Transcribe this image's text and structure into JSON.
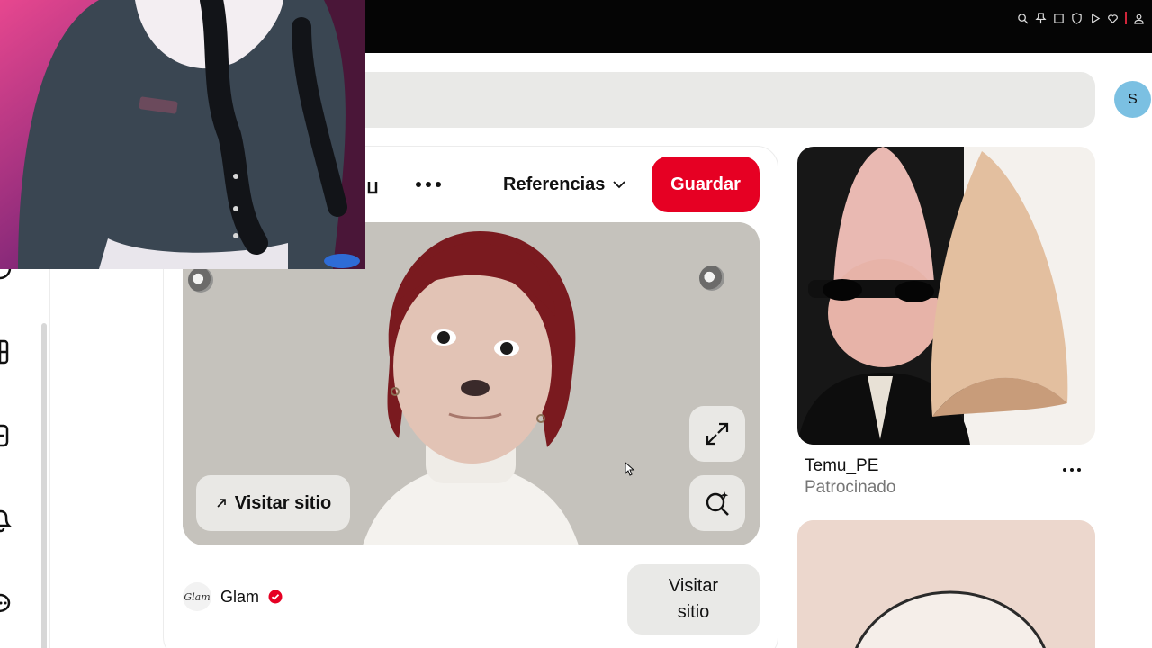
{
  "browser": {
    "icons": [
      "zoom-icon",
      "pin-icon",
      "screenshot-icon",
      "shield-icon",
      "play-icon",
      "heart-icon",
      "profile-icon"
    ],
    "accent": "#d0253a"
  },
  "header": {
    "avatar_initial": "S",
    "avatar_color": "#7bc0e2"
  },
  "sidebar": {
    "icons": [
      "messages-icon",
      "dashboard-icon",
      "create-icon",
      "notifications-icon",
      "chat-icon"
    ]
  },
  "pin": {
    "references_label": "Referencias",
    "save_label": "Guardar",
    "visit_overlay_label": "Visitar sitio",
    "visit_button_line1": "Visitar",
    "visit_button_line2": "sitio",
    "author": {
      "logo_text": "Glam",
      "name": "Glam",
      "verified": true
    },
    "brand_color": "#e60023"
  },
  "ad": {
    "advertiser": "Temu_PE",
    "label": "Patrocinado"
  }
}
